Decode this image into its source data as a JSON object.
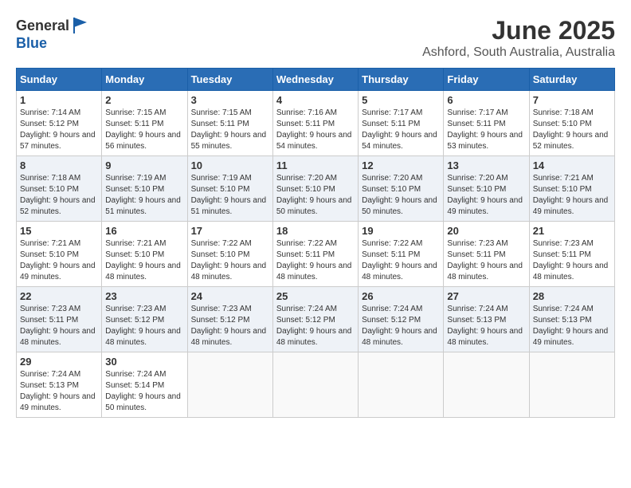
{
  "header": {
    "logo_general": "General",
    "logo_blue": "Blue",
    "month_year": "June 2025",
    "location": "Ashford, South Australia, Australia"
  },
  "weekdays": [
    "Sunday",
    "Monday",
    "Tuesday",
    "Wednesday",
    "Thursday",
    "Friday",
    "Saturday"
  ],
  "weeks": [
    [
      {
        "day": "1",
        "rise": "7:14 AM",
        "set": "5:12 PM",
        "daylight": "9 hours and 57 minutes."
      },
      {
        "day": "2",
        "rise": "7:15 AM",
        "set": "5:11 PM",
        "daylight": "9 hours and 56 minutes."
      },
      {
        "day": "3",
        "rise": "7:15 AM",
        "set": "5:11 PM",
        "daylight": "9 hours and 55 minutes."
      },
      {
        "day": "4",
        "rise": "7:16 AM",
        "set": "5:11 PM",
        "daylight": "9 hours and 54 minutes."
      },
      {
        "day": "5",
        "rise": "7:17 AM",
        "set": "5:11 PM",
        "daylight": "9 hours and 54 minutes."
      },
      {
        "day": "6",
        "rise": "7:17 AM",
        "set": "5:11 PM",
        "daylight": "9 hours and 53 minutes."
      },
      {
        "day": "7",
        "rise": "7:18 AM",
        "set": "5:10 PM",
        "daylight": "9 hours and 52 minutes."
      }
    ],
    [
      {
        "day": "8",
        "rise": "7:18 AM",
        "set": "5:10 PM",
        "daylight": "9 hours and 52 minutes."
      },
      {
        "day": "9",
        "rise": "7:19 AM",
        "set": "5:10 PM",
        "daylight": "9 hours and 51 minutes."
      },
      {
        "day": "10",
        "rise": "7:19 AM",
        "set": "5:10 PM",
        "daylight": "9 hours and 51 minutes."
      },
      {
        "day": "11",
        "rise": "7:20 AM",
        "set": "5:10 PM",
        "daylight": "9 hours and 50 minutes."
      },
      {
        "day": "12",
        "rise": "7:20 AM",
        "set": "5:10 PM",
        "daylight": "9 hours and 50 minutes."
      },
      {
        "day": "13",
        "rise": "7:20 AM",
        "set": "5:10 PM",
        "daylight": "9 hours and 49 minutes."
      },
      {
        "day": "14",
        "rise": "7:21 AM",
        "set": "5:10 PM",
        "daylight": "9 hours and 49 minutes."
      }
    ],
    [
      {
        "day": "15",
        "rise": "7:21 AM",
        "set": "5:10 PM",
        "daylight": "9 hours and 49 minutes."
      },
      {
        "day": "16",
        "rise": "7:21 AM",
        "set": "5:10 PM",
        "daylight": "9 hours and 48 minutes."
      },
      {
        "day": "17",
        "rise": "7:22 AM",
        "set": "5:10 PM",
        "daylight": "9 hours and 48 minutes."
      },
      {
        "day": "18",
        "rise": "7:22 AM",
        "set": "5:11 PM",
        "daylight": "9 hours and 48 minutes."
      },
      {
        "day": "19",
        "rise": "7:22 AM",
        "set": "5:11 PM",
        "daylight": "9 hours and 48 minutes."
      },
      {
        "day": "20",
        "rise": "7:23 AM",
        "set": "5:11 PM",
        "daylight": "9 hours and 48 minutes."
      },
      {
        "day": "21",
        "rise": "7:23 AM",
        "set": "5:11 PM",
        "daylight": "9 hours and 48 minutes."
      }
    ],
    [
      {
        "day": "22",
        "rise": "7:23 AM",
        "set": "5:11 PM",
        "daylight": "9 hours and 48 minutes."
      },
      {
        "day": "23",
        "rise": "7:23 AM",
        "set": "5:12 PM",
        "daylight": "9 hours and 48 minutes."
      },
      {
        "day": "24",
        "rise": "7:23 AM",
        "set": "5:12 PM",
        "daylight": "9 hours and 48 minutes."
      },
      {
        "day": "25",
        "rise": "7:24 AM",
        "set": "5:12 PM",
        "daylight": "9 hours and 48 minutes."
      },
      {
        "day": "26",
        "rise": "7:24 AM",
        "set": "5:12 PM",
        "daylight": "9 hours and 48 minutes."
      },
      {
        "day": "27",
        "rise": "7:24 AM",
        "set": "5:13 PM",
        "daylight": "9 hours and 48 minutes."
      },
      {
        "day": "28",
        "rise": "7:24 AM",
        "set": "5:13 PM",
        "daylight": "9 hours and 49 minutes."
      }
    ],
    [
      {
        "day": "29",
        "rise": "7:24 AM",
        "set": "5:13 PM",
        "daylight": "9 hours and 49 minutes."
      },
      {
        "day": "30",
        "rise": "7:24 AM",
        "set": "5:14 PM",
        "daylight": "9 hours and 50 minutes."
      },
      null,
      null,
      null,
      null,
      null
    ]
  ]
}
